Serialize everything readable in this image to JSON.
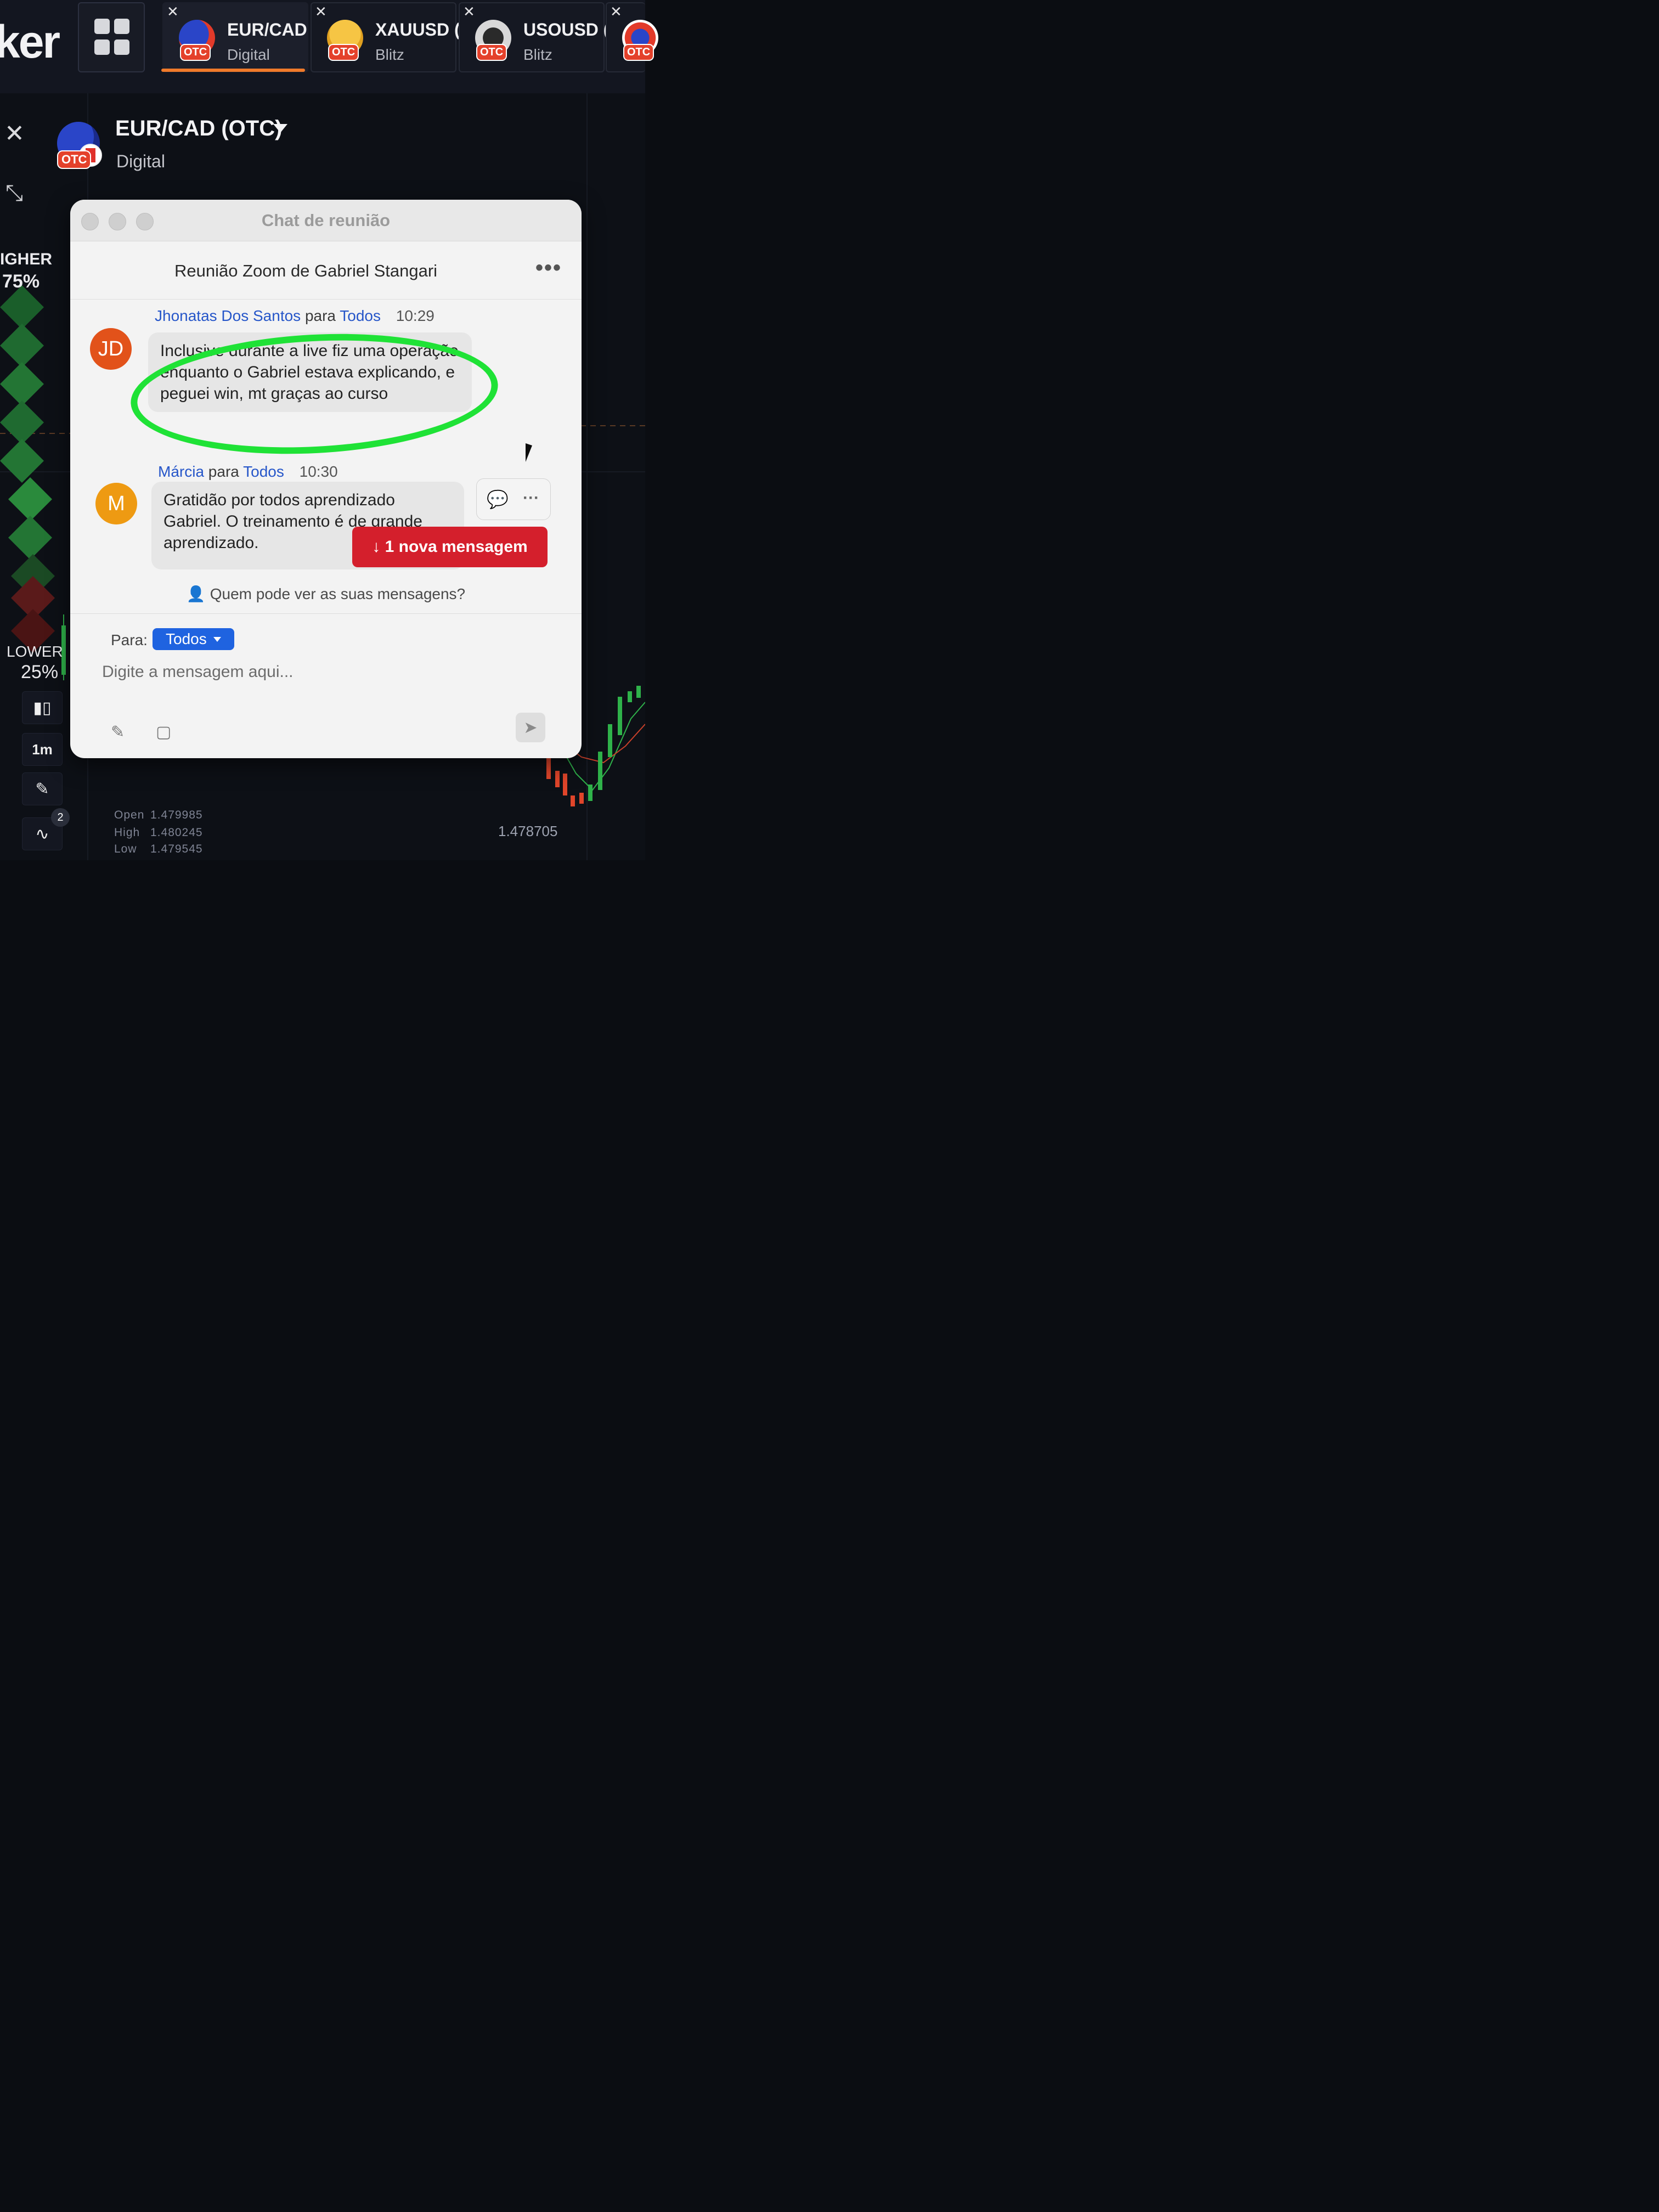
{
  "brand": {
    "text": "ker"
  },
  "tabs": [
    {
      "name": "EUR/CAD (",
      "type": "Digital",
      "badge": "OTC",
      "icon": "eur-cad-flag-icon",
      "active": true
    },
    {
      "name": "XAUUSD (",
      "type": "Blitz",
      "badge": "OTC",
      "icon": "gold-bars-icon",
      "active": false
    },
    {
      "name": "USOUSD (",
      "type": "Blitz",
      "badge": "OTC",
      "icon": "oil-drop-icon",
      "active": false
    },
    {
      "name": "",
      "type": "",
      "badge": "OTC",
      "icon": "us-flag-icon",
      "active": false
    }
  ],
  "asset_header": {
    "title": "EUR/CAD (OTC)",
    "type": "Digital",
    "badge": "OTC"
  },
  "trade": {
    "higher_label": "IGHER",
    "higher_pct": "75%",
    "lower_label": "LOWER",
    "lower_pct": "25%"
  },
  "toolbar": {
    "timeframe": "1m",
    "indicators_count": "2"
  },
  "ohlc": {
    "open_label": "Open",
    "open_value": "1.479985",
    "high_label": "High",
    "high_value": "1.480245",
    "low_label": "Low",
    "low_value": "1.479545"
  },
  "price_readout": "1.478705",
  "chat": {
    "window_title": "Chat de reunião",
    "meeting_name": "Reunião Zoom de Gabriel Stangari",
    "messages": [
      {
        "sender": "Jhonatas Dos Santos",
        "connector": "para",
        "recipient": "Todos",
        "time": "10:29",
        "initials": "JD",
        "avatar_color": "#e2521a",
        "text": "Inclusive durante a live fiz uma operação enquanto o Gabriel estava explicando, e peguei win, mt graças ao curso"
      },
      {
        "sender": "Márcia",
        "connector": "para",
        "recipient": "Todos",
        "time": "10:30",
        "initials": "M",
        "avatar_color": "#ee9a12",
        "text": "Gratidão por todos aprendizado Gabriel. O treinamento é de grande aprendizado."
      }
    ],
    "new_message_label": "↓ 1 nova mensagem",
    "privacy_text": "Quem pode ver as suas mensagens?",
    "to_label": "Para:",
    "to_value": "Todos",
    "input_placeholder": "Digite a mensagem aqui..."
  },
  "colors": {
    "accent_orange": "#f07a2a",
    "highlight_green": "#1fe236",
    "chip_blue": "#1f63e0",
    "alert_red": "#d41f2c"
  }
}
